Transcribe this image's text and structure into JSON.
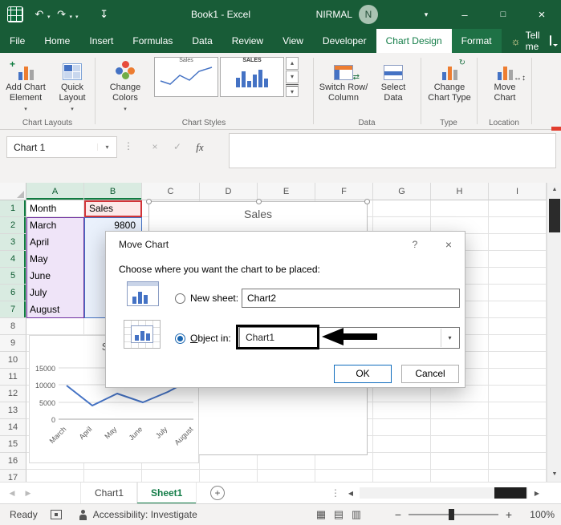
{
  "window": {
    "title": "Book1 - Excel",
    "user_name": "NIRMAL",
    "user_initial": "N"
  },
  "icons": {
    "undo": "↶",
    "redo": "↷",
    "caret": "▾",
    "pin": "↧",
    "ribbon_display": "▾",
    "minimize": "–",
    "maximize": "□",
    "close": "×",
    "bulb": "☼",
    "gallery_up": "▴",
    "gallery_down": "▾",
    "gallery_more": "▾",
    "name_caret": "▾",
    "dots": "⋮",
    "cancel": "×",
    "enter": "✓",
    "fx": "fx",
    "help": "?",
    "dialog_close": "×",
    "add_sheet": "+",
    "tab_left": "◀",
    "tab_right": "▶",
    "scroll_up": "▲",
    "scroll_down": "▼",
    "view_normal": "▦",
    "view_layout": "▤",
    "view_break": "▥",
    "zoom_out": "−",
    "zoom_in": "+",
    "swap": "⇄",
    "rotate": "↻",
    "move_h": "↔",
    "move_v": "↕"
  },
  "ribbon": {
    "tabs": [
      {
        "label": "File"
      },
      {
        "label": "Home"
      },
      {
        "label": "Insert"
      },
      {
        "label": "Formulas"
      },
      {
        "label": "Data"
      },
      {
        "label": "Review"
      },
      {
        "label": "View"
      },
      {
        "label": "Developer"
      },
      {
        "label": "Chart Design"
      },
      {
        "label": "Format"
      }
    ],
    "tell_me": "Tell me",
    "groups": {
      "chart_layouts": "Chart Layouts",
      "chart_styles": "Chart Styles",
      "data": "Data",
      "type": "Type",
      "location": "Location"
    },
    "buttons": {
      "add_chart_element": [
        "Add Chart",
        "Element"
      ],
      "quick_layout": [
        "Quick",
        "Layout"
      ],
      "change_colors": [
        "Change",
        "Colors"
      ],
      "switch_row_column": [
        "Switch Row/",
        "Column"
      ],
      "select_data": [
        "Select",
        "Data"
      ],
      "change_chart_type": [
        "Change",
        "Chart Type"
      ],
      "move_chart": [
        "Move",
        "Chart"
      ]
    },
    "style_gallery": {
      "thumb1_title": "Sales",
      "thumb2_title": "SALES"
    }
  },
  "formula_bar": {
    "name_box": "Chart 1",
    "formula": ""
  },
  "sheet": {
    "columns": [
      "A",
      "B",
      "C",
      "D",
      "E",
      "F",
      "G",
      "H",
      "I"
    ],
    "rows": [
      1,
      2,
      3,
      4,
      5,
      6,
      7,
      8,
      9,
      10,
      11,
      12,
      13,
      14,
      15,
      16,
      17
    ],
    "cells": {
      "A1": "Month",
      "B1": "Sales",
      "A2": "March",
      "B2": "9800",
      "A3": "April",
      "A4": "May",
      "A5": "June",
      "A6": "July",
      "A7": "August"
    }
  },
  "chart_data": {
    "type": "line",
    "title": "Sales",
    "categories": [
      "March",
      "April",
      "May",
      "June",
      "July",
      "August"
    ],
    "series": [
      {
        "name": "Sales",
        "values": [
          9800,
          4000,
          7500,
          5000,
          8000,
          12000
        ]
      }
    ],
    "ylim": [
      0,
      15000
    ],
    "yticks": [
      15000,
      10000,
      5000,
      0
    ],
    "grid": true,
    "legend": false
  },
  "dialog": {
    "title": "Move Chart",
    "prompt": "Choose where you want the chart to be placed:",
    "new_sheet_label": "New sheet:",
    "new_sheet_value": "Chart2",
    "object_in_accel": "O",
    "object_in_rest": "bject in:",
    "object_in_value": "Chart1",
    "ok_label": "OK",
    "cancel_label": "Cancel"
  },
  "sheet_tabs": [
    {
      "label": "Chart1"
    },
    {
      "label": "Sheet1"
    }
  ],
  "status_bar": {
    "mode": "Ready",
    "accessibility": "Accessibility: Investigate",
    "zoom_level": "100%"
  },
  "colors": {
    "excel_green": "#185C37",
    "accent_green": "#107C41",
    "selection_purple": "#7030A0",
    "selection_red": "#D13438",
    "selection_blue": "#4472C4",
    "annotation": "#000000"
  }
}
